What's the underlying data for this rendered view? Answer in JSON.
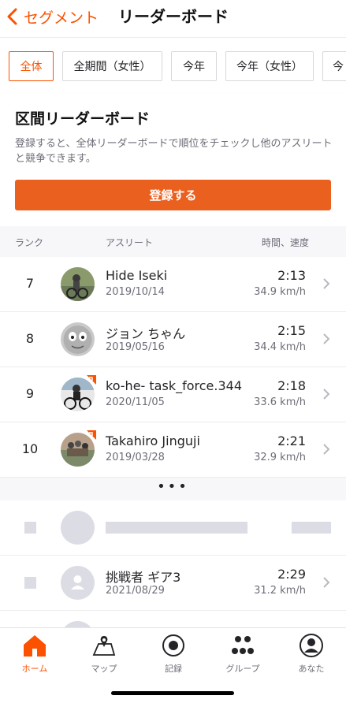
{
  "header": {
    "back_label": "セグメント",
    "title": "リーダーボード"
  },
  "filters": [
    {
      "label": "全体",
      "active": true
    },
    {
      "label": "全期間（女性）",
      "active": false
    },
    {
      "label": "今年",
      "active": false
    },
    {
      "label": "今年（女性）",
      "active": false
    },
    {
      "label": "今",
      "active": false
    }
  ],
  "promo": {
    "title": "区間リーダーボード",
    "description": "登録すると、全体リーダーボードで順位をチェックし他のアスリートと競争できます。",
    "cta_label": "登録する"
  },
  "table": {
    "col_rank": "ランク",
    "col_athlete": "アスリート",
    "col_time": "時間、速度",
    "rows": [
      {
        "rank": "7",
        "name": "Hide Iseki",
        "date": "2019/10/14",
        "time": "2:13",
        "speed": "34.9 km/h"
      },
      {
        "rank": "8",
        "name": "ジョン ちゃん",
        "date": "2019/05/16",
        "time": "2:15",
        "speed": "34.4 km/h"
      },
      {
        "rank": "9",
        "name": "ko-he- task_force.344",
        "date": "2020/11/05",
        "time": "2:18",
        "speed": "33.6 km/h"
      },
      {
        "rank": "10",
        "name": "Takahiro Jinguji",
        "date": "2019/03/28",
        "time": "2:21",
        "speed": "32.9 km/h"
      }
    ],
    "ellipsis": "•••",
    "challenger": {
      "name": "挑戦者 ギア3",
      "date": "2021/08/29",
      "time": "2:29",
      "speed": "31.2 km/h"
    }
  },
  "nav": [
    {
      "label": "ホーム",
      "icon": "home-icon",
      "active": true
    },
    {
      "label": "マップ",
      "icon": "map-icon",
      "active": false
    },
    {
      "label": "記録",
      "icon": "record-icon",
      "active": false
    },
    {
      "label": "グループ",
      "icon": "groups-icon",
      "active": false
    },
    {
      "label": "あなた",
      "icon": "profile-icon",
      "active": false
    }
  ],
  "colors": {
    "accent": "#fc5200",
    "button": "#e9601f",
    "text": "#242428",
    "muted": "#6d6d78",
    "placeholder": "#dcdce4"
  }
}
